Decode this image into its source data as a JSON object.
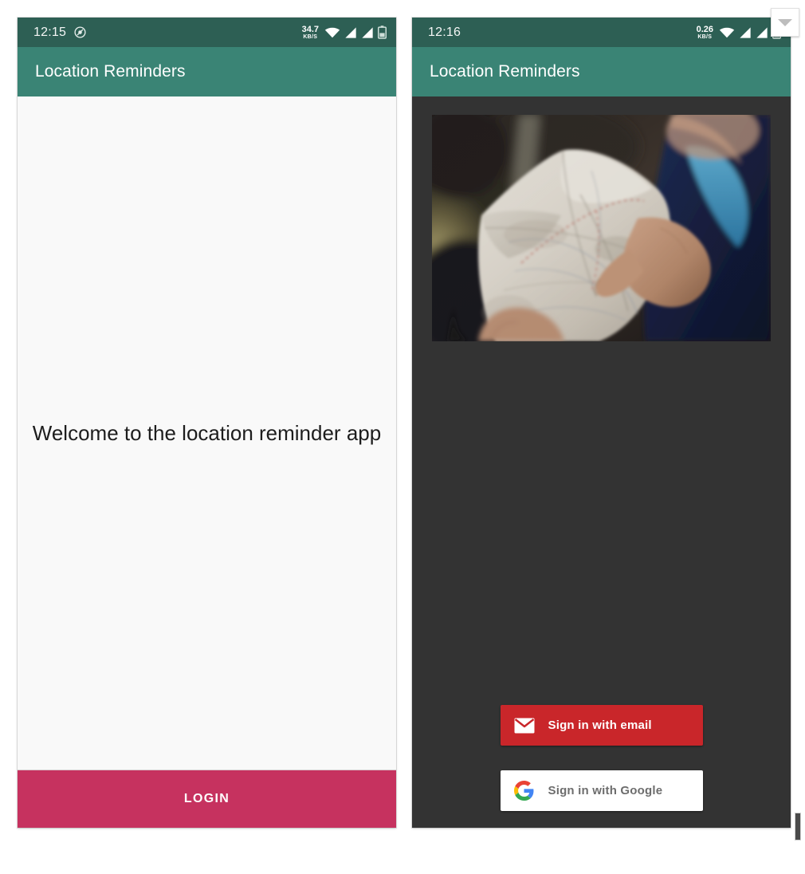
{
  "app": {
    "name": "Location Reminders",
    "accent_teal": "#3a8475",
    "statusbar_teal": "#2d5f54",
    "login_crimson": "#c6325f",
    "email_red": "#c9262a",
    "dark_bg": "#333333",
    "light_bg": "#f9f9f9"
  },
  "screens": [
    {
      "id": "welcome-screen",
      "statusbar": {
        "clock": "12:15",
        "network_speed_value": "34.7",
        "network_speed_unit": "KB/S",
        "icons": [
          "gps-icon",
          "wifi-icon",
          "signal-icon",
          "signal-icon",
          "battery-icon"
        ]
      },
      "appbar": {
        "title": "Location Reminders"
      },
      "content": {
        "welcome_text": "Welcome to the location reminder app"
      },
      "footer": {
        "login_label": "LOGIN"
      }
    },
    {
      "id": "auth-screen",
      "statusbar": {
        "clock": "12:16",
        "network_speed_value": "0.26",
        "network_speed_unit": "KB/S",
        "icons": [
          "wifi-icon",
          "signal-icon",
          "signal-icon",
          "battery-icon"
        ]
      },
      "appbar": {
        "title": "Location Reminders"
      },
      "content": {
        "hero_image_alt": "Hands holding and pointing at a folded paper topographic map outdoors"
      },
      "auth_buttons": [
        {
          "id": "sign-in-email",
          "label": "Sign in with email",
          "icon": "envelope-icon",
          "color": "#c9262a"
        },
        {
          "id": "sign-in-google",
          "label": "Sign in with Google",
          "icon": "google-g-icon",
          "color": "#ffffff"
        }
      ]
    }
  ],
  "overlays": {
    "dropdown_chip_icon": "chevron-down-icon",
    "scrollbar": "vertical-scrollbar"
  }
}
